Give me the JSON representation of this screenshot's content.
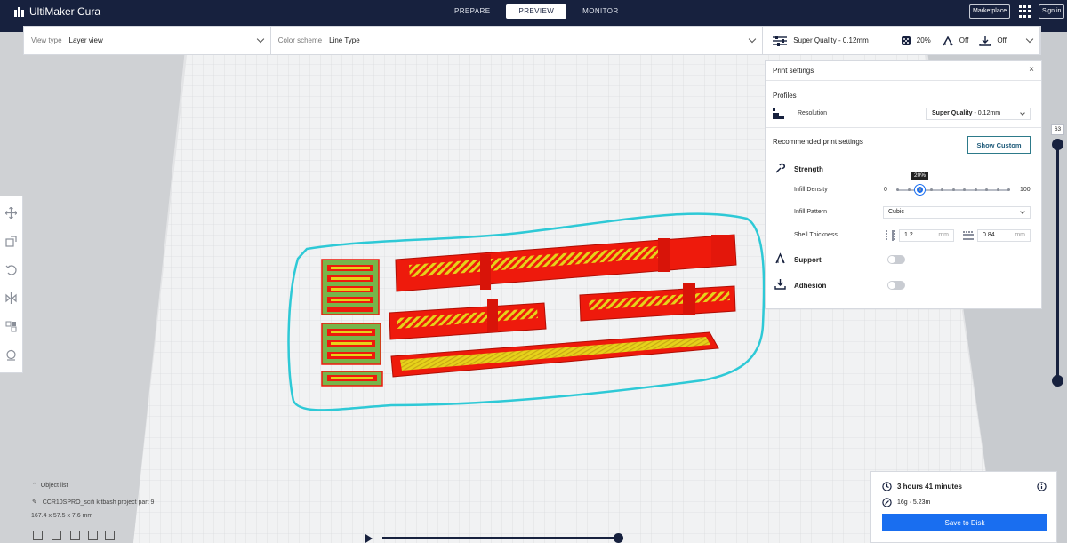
{
  "app": {
    "title": "UltiMaker Cura"
  },
  "stages": [
    {
      "label": "PREPARE",
      "active": false
    },
    {
      "label": "PREVIEW",
      "active": true
    },
    {
      "label": "MONITOR",
      "active": false
    }
  ],
  "header": {
    "marketplace_label": "Marketplace",
    "signin_label": "Sign in"
  },
  "toolbar": {
    "view_type_label": "View type",
    "view_type_value": "Layer view",
    "color_scheme_label": "Color scheme",
    "color_scheme_value": "Line Type",
    "profile_summary": "Super Quality - 0.12mm",
    "infill_summary": "20%",
    "support_summary": "Off",
    "adhesion_summary": "Off"
  },
  "print_settings": {
    "title": "Print settings",
    "profiles_heading": "Profiles",
    "resolution_label": "Resolution",
    "resolution_value_bold": "Super Quality",
    "resolution_value_rest": " - 0.12mm",
    "recommended_heading": "Recommended print settings",
    "show_custom_label": "Show Custom",
    "strength_label": "Strength",
    "infill_density_label": "Infill Density",
    "infill_min": "0",
    "infill_max": "100",
    "infill_tooltip": "20%",
    "infill_density_value": 0.2,
    "infill_pattern_label": "Infill Pattern",
    "infill_pattern_value": "Cubic",
    "shell_thickness_label": "Shell Thickness",
    "wall_thickness_value": "1.2",
    "top_bottom_value": "0.84",
    "unit_mm": "mm",
    "support_label": "Support",
    "support_enabled": false,
    "adhesion_label": "Adhesion",
    "adhesion_enabled": false
  },
  "layer_slider": {
    "current_layer": "63"
  },
  "object_list": {
    "toggle_label": "Object list",
    "file_name": "CCR10SPRO_scifi kitbash project part 9",
    "dimensions": "167.4 x 57.5 x 7.6 mm"
  },
  "output": {
    "print_time": "3 hours 41 minutes",
    "material": "16g · 5.23m",
    "save_label": "Save to Disk"
  },
  "colors": {
    "header_bg": "#17213e",
    "accent_blue": "#196ef0",
    "wall_red": "#ee1a0c",
    "infill_yellow": "#e6d21a",
    "skirt_cyan": "#2ec9d6",
    "top_green": "#77b54a"
  }
}
